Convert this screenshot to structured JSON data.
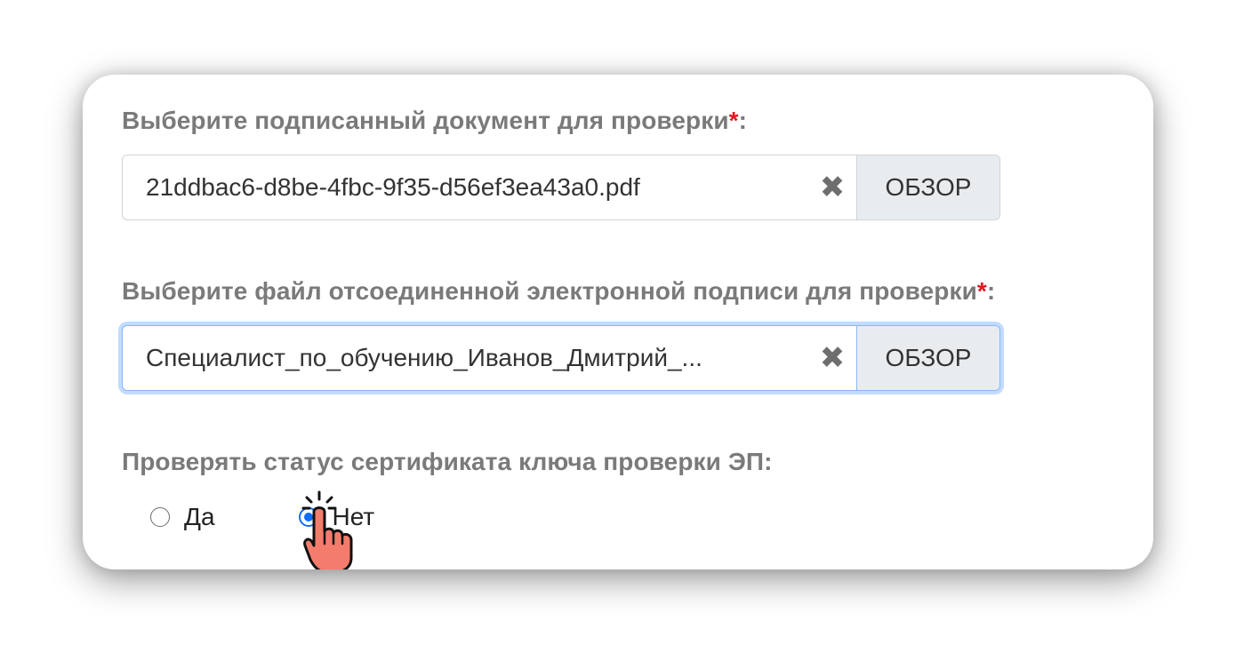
{
  "document_label": "Выберите подписанный документ для проверки",
  "signature_label": "Выберите файл отсоединенной электронной подписи для проверки",
  "required_mark": "*",
  "label_suffix": ":",
  "document_file": {
    "name": "21ddbac6-d8be-4fbc-9f35-d56ef3ea43a0.pdf",
    "clear_icon": "✖",
    "browse_label": "ОБЗОР"
  },
  "signature_file": {
    "name": "Специалист_по_обучению_Иванов_Дмитрий_...",
    "clear_icon": "✖",
    "browse_label": "ОБЗОР"
  },
  "status_label": "Проверять статус сертификата ключа проверки ЭП:",
  "radio_options": [
    {
      "label": "Да",
      "checked": false
    },
    {
      "label": "Нет",
      "checked": true
    }
  ],
  "colors": {
    "label": "#7a7a7a",
    "required": "#e0191f",
    "focus": "#86b7fe",
    "browse_bg": "#e9ecef",
    "cursor_hand": "#f47c6c"
  },
  "icons": {
    "clear": "close-icon",
    "pointer": "hand-pointer-icon"
  }
}
